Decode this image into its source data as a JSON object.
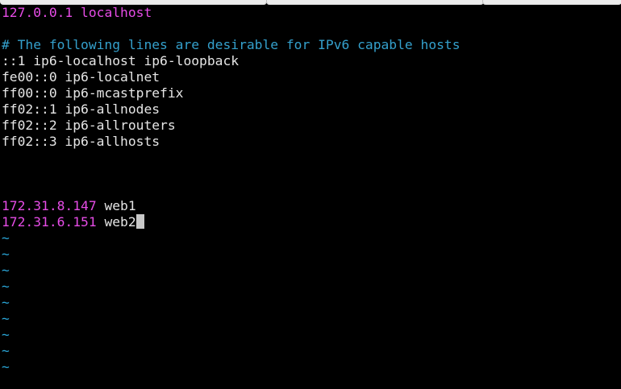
{
  "file_lines": [
    {
      "ip": "127.0.0.1",
      "host": "localhost"
    },
    {
      "blank": true
    },
    {
      "comment": "# The following lines are desirable for IPv6 capable hosts"
    },
    {
      "text": "::1 ip6-localhost ip6-loopback"
    },
    {
      "text": "fe00::0 ip6-localnet"
    },
    {
      "text": "ff00::0 ip6-mcastprefix"
    },
    {
      "text": "ff02::1 ip6-allnodes"
    },
    {
      "text": "ff02::2 ip6-allrouters"
    },
    {
      "text": "ff02::3 ip6-allhosts"
    }
  ],
  "hosts": {
    "localhost_ip": "127.0.0.1",
    "localhost_name": "localhost",
    "comment": "# The following lines are desirable for IPv6 capable hosts",
    "ipv6": [
      "::1 ip6-localhost ip6-loopback",
      "fe00::0 ip6-localnet",
      "ff00::0 ip6-mcastprefix",
      "ff02::1 ip6-allnodes",
      "ff02::2 ip6-allrouters",
      "ff02::3 ip6-allhosts"
    ],
    "web1_ip": "172.31.8.147",
    "web1_name": "web1",
    "web2_ip": "172.31.6.151",
    "web2_name": "web2"
  },
  "empty_line_marker": "~",
  "colors": {
    "background": "#000000",
    "ip_text": "#e64ce6",
    "comment_text": "#34a0cc",
    "plain_text": "#e5e5e5",
    "tilde": "#2aa7d9",
    "cursor": "#c8c8c8"
  }
}
